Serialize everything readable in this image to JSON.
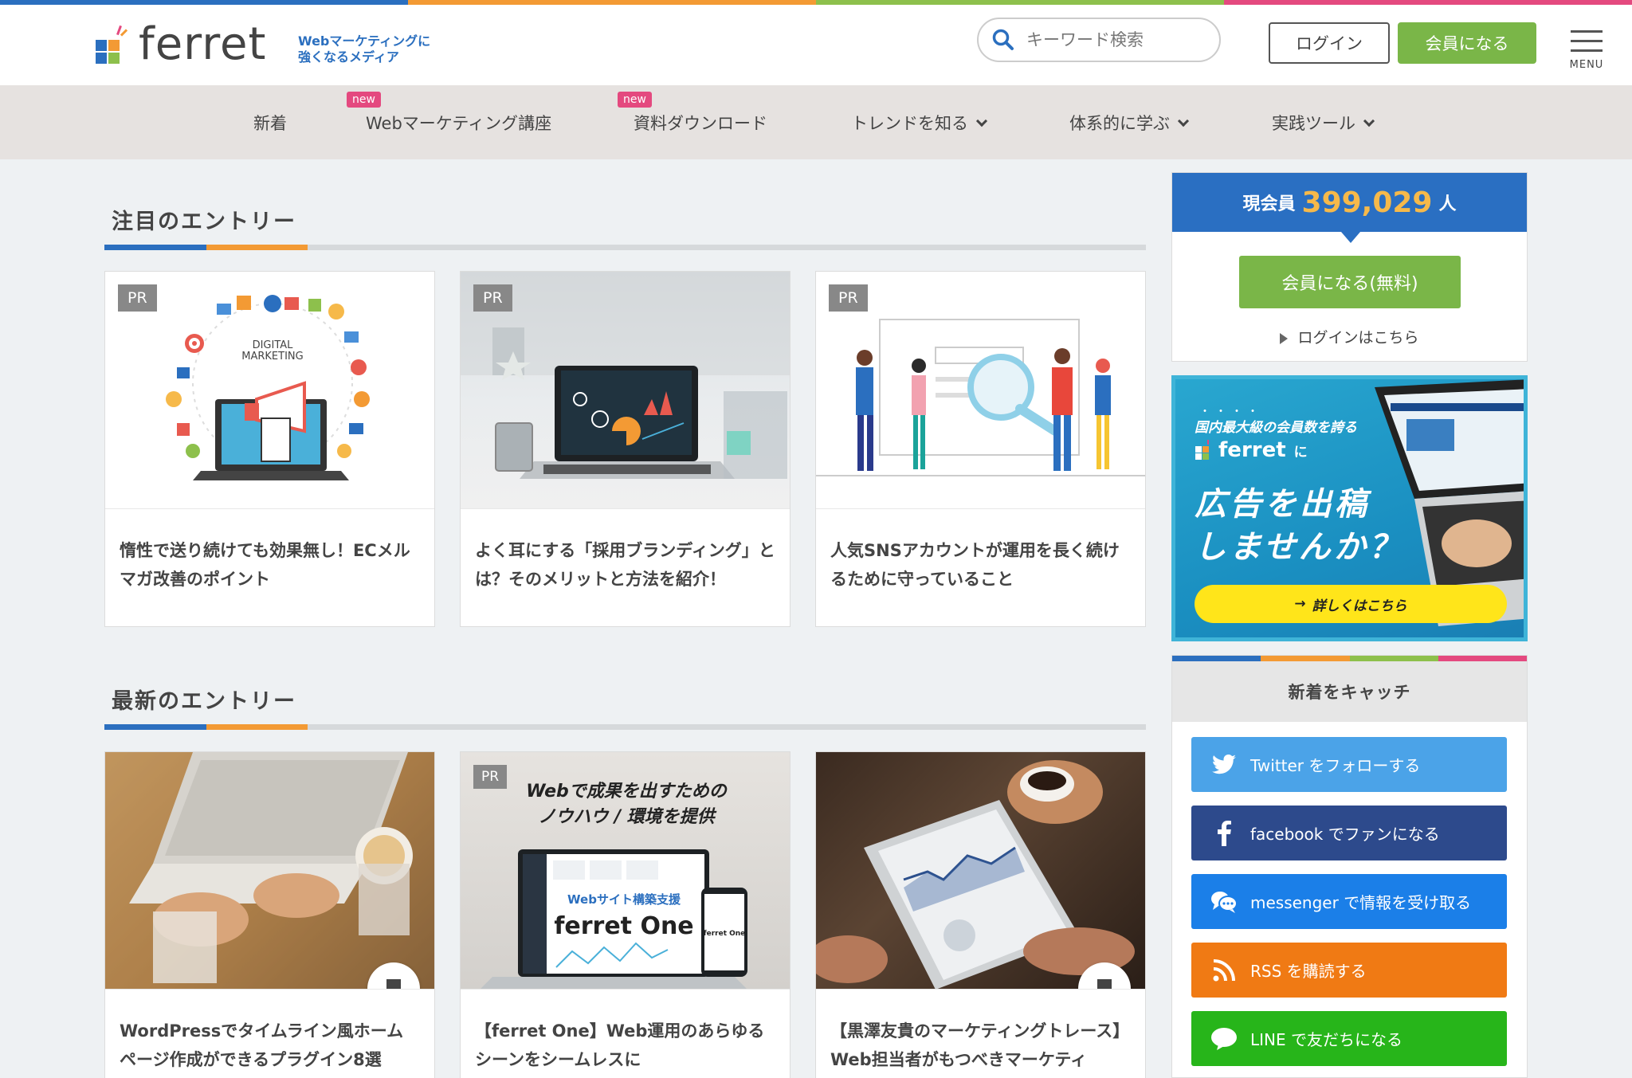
{
  "brand": {
    "name": "ferret",
    "tagline_line1": "Webマーケティングに",
    "tagline_line2": "強くなるメディア",
    "stripe_colors": [
      "#2b6fbf",
      "#f39a34",
      "#8dc04c",
      "#e4497f"
    ]
  },
  "header": {
    "search_placeholder": "キーワード検索",
    "login_label": "ログイン",
    "join_label": "会員になる",
    "menu_label": "MENU"
  },
  "nav": {
    "items": [
      {
        "label": "新着",
        "badge": "",
        "dropdown": false
      },
      {
        "label": "Webマーケティング講座",
        "badge": "new",
        "dropdown": false
      },
      {
        "label": "資料ダウンロード",
        "badge": "new",
        "dropdown": false
      },
      {
        "label": "トレンドを知る",
        "badge": "",
        "dropdown": true
      },
      {
        "label": "体系的に学ぶ",
        "badge": "",
        "dropdown": true
      },
      {
        "label": "実践ツール",
        "badge": "",
        "dropdown": true
      }
    ]
  },
  "featured": {
    "title": "注目のエントリー",
    "cards": [
      {
        "tag": "PR",
        "title": "惰性で送り続けても効果無し！ECメルマガ改善のポイント",
        "image_text_1": "DIGITAL",
        "image_text_2": "MARKETING"
      },
      {
        "tag": "PR",
        "title": "よく耳にする「採用ブランディング」とは？そのメリットと方法を紹介！"
      },
      {
        "tag": "PR",
        "title": "人気SNSアカウントが運用を長く続けるために守っていること"
      }
    ]
  },
  "latest": {
    "title": "最新のエントリー",
    "cards": [
      {
        "tag": "",
        "title": "WordPressでタイムライン風ホームページ作成ができるプラグイン8選"
      },
      {
        "tag": "PR",
        "title": "【ferret One】Web運用のあらゆるシーンをシームレスに",
        "image_head_1": "Webで成果を出すための",
        "image_head_2": "ノウハウ / 環境を提供",
        "image_sub": "Webサイト構築支援",
        "image_brand": "ferret One",
        "image_phone_brand": "ferret One"
      },
      {
        "tag": "",
        "title": "【黒澤友貴のマーケティングトレース】Web担当者がもつべきマーケティ"
      }
    ]
  },
  "sidebar": {
    "members_prefix": "現会員",
    "members_count": "399,029",
    "members_suffix": "人",
    "join_free_label": "会員になる(無料)",
    "login_link": "ログインはこちら",
    "ad": {
      "dots": "・・・・",
      "line1": "国内最大級の会員数を誇る",
      "brand": "ferret",
      "brand_suffix": "に",
      "headline1": "広告を出稿",
      "headline2": "しませんか？",
      "cta": "詳しくはこちら"
    },
    "catch_title": "新着をキャッチ",
    "social": [
      {
        "label": "Twitter をフォローする",
        "color": "#4ba3e8",
        "icon": "twitter-icon"
      },
      {
        "label": "facebook でファンになる",
        "color": "#2d4a8c",
        "icon": "facebook-icon"
      },
      {
        "label": "messenger で情報を受け取る",
        "color": "#1b7fe8",
        "icon": "messenger-icon"
      },
      {
        "label": "RSS を購読する",
        "color": "#f07a14",
        "icon": "rss-icon"
      },
      {
        "label": "LINE で友だちになる",
        "color": "#27b51a",
        "icon": "line-icon"
      }
    ]
  }
}
